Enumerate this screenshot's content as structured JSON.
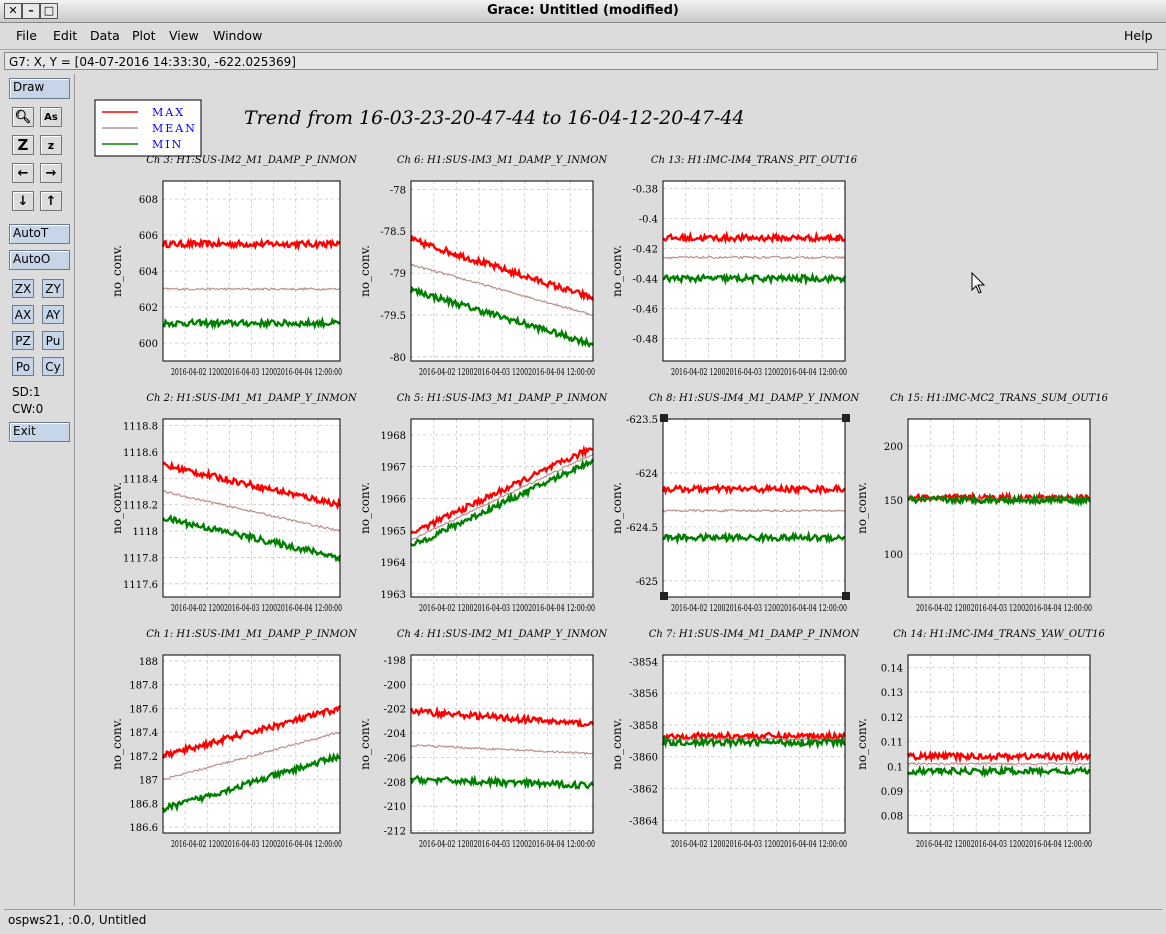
{
  "window": {
    "title": "Grace: Untitled (modified)",
    "controls": [
      "close-icon",
      "minimize-icon",
      "maximize-icon"
    ]
  },
  "menubar": {
    "items": [
      "File",
      "Edit",
      "Data",
      "Plot",
      "View",
      "Window"
    ],
    "help": "Help"
  },
  "coordinates": "G7: X, Y = [04-07-2016 14:33:30, -622.025369]",
  "toolbar": {
    "draw": "Draw",
    "icon_buttons": [
      "zoom-icon",
      "autoscale-text-icon",
      "zoom-in-icon",
      "zoom-out-icon",
      "arrow-left-icon",
      "arrow-right-icon",
      "arrow-down-icon",
      "arrow-up-icon"
    ],
    "autot": "AutoT",
    "autoo": "AutoO",
    "small_buttons": [
      "ZX",
      "ZY",
      "AX",
      "AY",
      "PZ",
      "Pu",
      "Po",
      "Cy"
    ],
    "sd": "SD:1",
    "cw": "CW:0",
    "exit": "Exit"
  },
  "statusbar": "ospws21, :0.0, Untitled",
  "plot": {
    "main_title": "Trend from 16-03-23-20-47-44 to 16-04-12-20-47-44",
    "legend": [
      {
        "label": "MAX",
        "color": "#ff0000"
      },
      {
        "label": "MEAN",
        "color": "#bc8f8f"
      },
      {
        "label": "MIN",
        "color": "#008000"
      }
    ],
    "legend_text_color": "#0000ff",
    "ylabel": "no_conv.",
    "xtick_labels": [
      "2016-04-02 12:00:00",
      "2016-04-03 12:00:00",
      "2016-04-04 12:00:00"
    ],
    "xtick_visible": "2016-04-02 12",
    "xtick_overlap": [
      "00",
      "2016-04-03 12",
      "00",
      "2016-04-04 12:00:00"
    ]
  },
  "chart_data": [
    {
      "type": "line",
      "title": "Ch 3: H1:SUS-IM2_M1_DAMP_P_INMON",
      "ylabel": "no_conv.",
      "yticks": [
        "600",
        "602",
        "604",
        "606",
        "608"
      ],
      "ylim": [
        599,
        609
      ],
      "series": [
        {
          "name": "MAX",
          "level": 605.5
        },
        {
          "name": "MEAN",
          "level": 603.0
        },
        {
          "name": "MIN",
          "level": 601.1
        }
      ]
    },
    {
      "type": "line",
      "title": "Ch 6: H1:SUS-IM3_M1_DAMP_Y_INMON",
      "ylabel": "no_conv.",
      "yticks": [
        "-78",
        "-78.5",
        "-79",
        "-79.5",
        "-80"
      ],
      "ylim": [
        -80.05,
        -77.9
      ],
      "series": [
        {
          "name": "MAX",
          "start": -78.6,
          "end": -79.3
        },
        {
          "name": "MEAN",
          "start": -78.9,
          "end": -79.5
        },
        {
          "name": "MIN",
          "start": -79.2,
          "end": -79.85
        }
      ]
    },
    {
      "type": "line",
      "title": "Ch 13: H1:IMC-IM4_TRANS_PIT_OUT16",
      "ylabel": "no_conv.",
      "yticks": [
        "-0.38",
        "-0.4",
        "-0.42",
        "-0.44",
        "-0.46",
        "-0.48"
      ],
      "ylim": [
        -0.495,
        -0.375
      ],
      "series": [
        {
          "name": "MAX",
          "level": -0.413
        },
        {
          "name": "MEAN",
          "level": -0.426
        },
        {
          "name": "MIN",
          "level": -0.44
        }
      ]
    },
    {
      "type": "line",
      "title": "Ch 2: H1:SUS-IM1_M1_DAMP_Y_INMON",
      "ylabel": "no_conv.",
      "yticks": [
        "1118.8",
        "1118.6",
        "1118.4",
        "1118.2",
        "1118",
        "1117.8",
        "1117.6"
      ],
      "ylim": [
        1117.5,
        1118.85
      ],
      "series": [
        {
          "name": "MAX",
          "start": 1118.5,
          "end": 1118.2
        },
        {
          "name": "MEAN",
          "start": 1118.3,
          "end": 1118.0
        },
        {
          "name": "MIN",
          "start": 1118.1,
          "end": 1117.8
        }
      ]
    },
    {
      "type": "line",
      "title": "Ch 5: H1:SUS-IM3_M1_DAMP_P_INMON",
      "ylabel": "no_conv.",
      "yticks": [
        "1968",
        "1967",
        "1966",
        "1965",
        "1964",
        "1963"
      ],
      "ylim": [
        1962.9,
        1968.5
      ],
      "series": [
        {
          "name": "MAX",
          "start": 1964.9,
          "end": 1967.6
        },
        {
          "name": "MEAN",
          "start": 1964.7,
          "end": 1967.4
        },
        {
          "name": "MIN",
          "start": 1964.5,
          "end": 1967.2
        }
      ]
    },
    {
      "type": "line",
      "title": "Ch 8: H1:SUS-IM4_M1_DAMP_Y_INMON",
      "ylabel": "no_conv.",
      "yticks": [
        "-623.5",
        "-624",
        "-624.5",
        "-625"
      ],
      "ylim": [
        -625.15,
        -623.5
      ],
      "series": [
        {
          "name": "MAX",
          "level": -624.15
        },
        {
          "name": "MEAN",
          "level": -624.35
        },
        {
          "name": "MIN",
          "level": -624.6
        }
      ]
    },
    {
      "type": "line",
      "title": "Ch 15: H1:IMC-MC2_TRANS_SUM_OUT16",
      "ylabel": "no_conv.",
      "yticks": [
        "200",
        "150",
        "100"
      ],
      "ylim": [
        60,
        225
      ],
      "series": [
        {
          "name": "MAX",
          "level": 152
        },
        {
          "name": "MEAN",
          "level": 151
        },
        {
          "name": "MIN",
          "level": 150
        }
      ]
    },
    {
      "type": "line",
      "title": "Ch 1: H1:SUS-IM1_M1_DAMP_P_INMON",
      "ylabel": "no_conv.",
      "yticks": [
        "188",
        "187.8",
        "187.6",
        "187.4",
        "187.2",
        "187",
        "186.8",
        "186.6"
      ],
      "ylim": [
        186.55,
        188.05
      ],
      "series": [
        {
          "name": "MAX",
          "start": 187.2,
          "end": 187.6
        },
        {
          "name": "MEAN",
          "start": 187.0,
          "end": 187.4
        },
        {
          "name": "MIN",
          "start": 186.75,
          "end": 187.2
        }
      ]
    },
    {
      "type": "line",
      "title": "Ch 4: H1:SUS-IM2_M1_DAMP_Y_INMON",
      "ylabel": "no_conv.",
      "yticks": [
        "-198",
        "-200",
        "-202",
        "-204",
        "-206",
        "-208",
        "-210",
        "-212"
      ],
      "ylim": [
        -212.2,
        -197.6
      ],
      "series": [
        {
          "name": "MAX",
          "start": -202.2,
          "end": -203.3
        },
        {
          "name": "MEAN",
          "start": -205.0,
          "end": -205.7
        },
        {
          "name": "MIN",
          "start": -207.8,
          "end": -208.3
        }
      ]
    },
    {
      "type": "line",
      "title": "Ch 7: H1:SUS-IM4_M1_DAMP_P_INMON",
      "ylabel": "no_conv.",
      "yticks": [
        "-3854",
        "-3856",
        "-3858",
        "-3860",
        "-3862",
        "-3864"
      ],
      "ylim": [
        -3864.8,
        -3853.6
      ],
      "series": [
        {
          "name": "MAX",
          "level": -3858.7
        },
        {
          "name": "MEAN",
          "level": -3858.9
        },
        {
          "name": "MIN",
          "level": -3859.1
        }
      ]
    },
    {
      "type": "line",
      "title": "Ch 14: H1:IMC-IM4_TRANS_YAW_OUT16",
      "ylabel": "no_conv.",
      "yticks": [
        "0.14",
        "0.13",
        "0.12",
        "0.11",
        "0.1",
        "0.09",
        "0.08"
      ],
      "ylim": [
        0.073,
        0.145
      ],
      "series": [
        {
          "name": "MAX",
          "level": 0.104
        },
        {
          "name": "MEAN",
          "level": 0.101
        },
        {
          "name": "MIN",
          "level": 0.098
        }
      ]
    }
  ]
}
